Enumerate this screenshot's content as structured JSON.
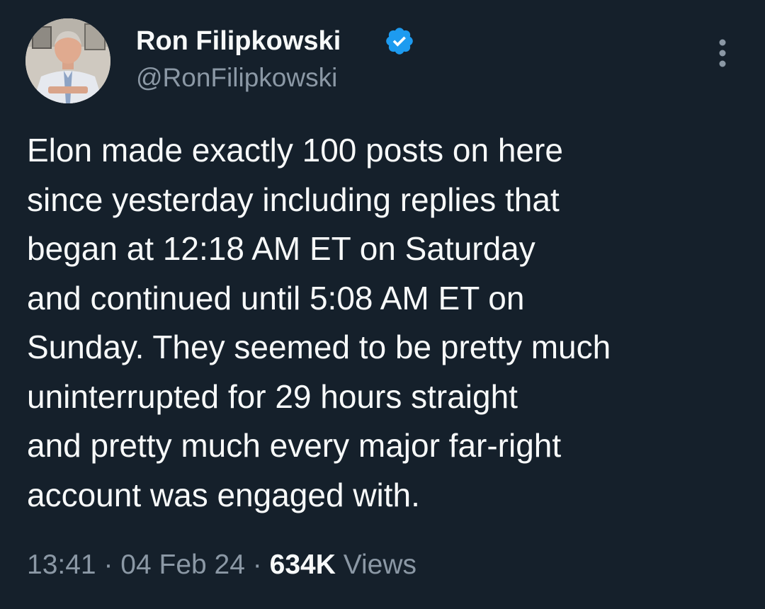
{
  "author": {
    "display_name": "Ron Filipkowski",
    "handle": "@RonFilipkowski",
    "verified": true,
    "avatar": "profile-photo"
  },
  "tweet": {
    "text_lines": [
      "Elon made exactly 100 posts on here",
      "since yesterday including replies that",
      "began at 12:18 AM ET on Saturday",
      "and continued until 5:08 AM ET on",
      "Sunday. They seemed to be pretty much",
      "uninterrupted for 29 hours straight",
      "and pretty much every major far-right",
      "account was engaged with."
    ],
    "time": "13:41",
    "separator": "·",
    "date": "04 Feb 24",
    "views_count": "634K",
    "views_label": "Views"
  },
  "icons": {
    "verified": "verified-badge-icon",
    "more": "more-options-icon"
  },
  "colors": {
    "background": "#15202b",
    "primary_text": "#f7f9f9",
    "secondary_text": "#8b98a5",
    "verified_blue": "#1d9bf0"
  }
}
